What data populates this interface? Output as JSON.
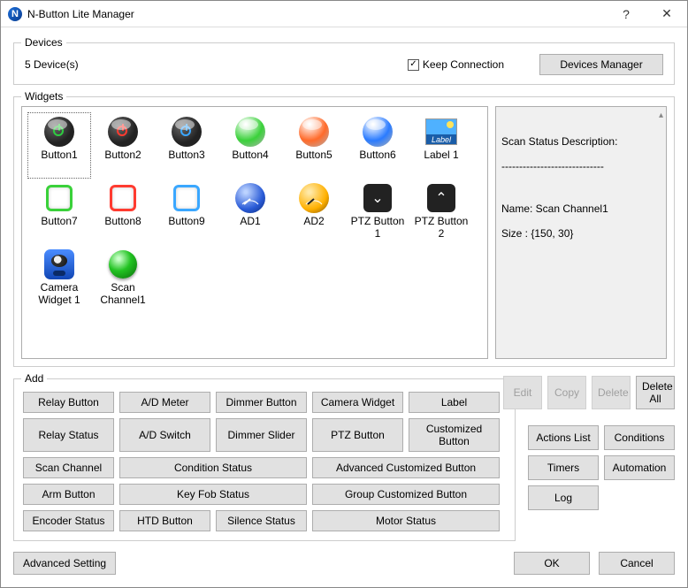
{
  "title": "N-Button Lite Manager",
  "titlebar": {
    "help": "?",
    "close": "✕"
  },
  "devices": {
    "legend": "Devices",
    "count_text": "5 Device(s)",
    "keep_label": "Keep Connection",
    "keep_checked": true,
    "manager_btn": "Devices Manager"
  },
  "widgets": {
    "legend": "Widgets",
    "items": [
      {
        "name": "Button1",
        "kind": "round",
        "bg": "#222",
        "fg": "#2ecc40",
        "selected": true
      },
      {
        "name": "Button2",
        "kind": "round",
        "bg": "#222",
        "fg": "#ff3b30"
      },
      {
        "name": "Button3",
        "kind": "round",
        "bg": "#222",
        "fg": "#3aa7ff"
      },
      {
        "name": "Button4",
        "kind": "dome",
        "bg": "#3ad13a"
      },
      {
        "name": "Button5",
        "kind": "dome",
        "bg": "#ff6a2a"
      },
      {
        "name": "Button6",
        "kind": "dome",
        "bg": "#2a7bff"
      },
      {
        "name": "Label 1",
        "kind": "label"
      },
      {
        "name": "Button7",
        "kind": "square",
        "border": "#3ad13a"
      },
      {
        "name": "Button8",
        "kind": "square",
        "border": "#ff3b30"
      },
      {
        "name": "Button9",
        "kind": "square",
        "border": "#3aa7ff"
      },
      {
        "name": "AD1",
        "kind": "gauge",
        "bg": "#2a5bd7"
      },
      {
        "name": "AD2",
        "kind": "gauge",
        "bg": "#ffb000"
      },
      {
        "name": "PTZ Button 1",
        "kind": "ptz",
        "arrow": "⌄"
      },
      {
        "name": "PTZ Button 2",
        "kind": "ptz",
        "arrow": "⌃"
      },
      {
        "name": "Camera Widget 1",
        "kind": "camera"
      },
      {
        "name": "Scan Channel1",
        "kind": "ball"
      }
    ],
    "desc_header": "Scan Status Description:",
    "desc_sep": "-----------------------------",
    "desc_name": "Name: Scan Channel1",
    "desc_size": "Size : {150, 30}"
  },
  "item_actions": {
    "edit": "Edit",
    "copy": "Copy",
    "delete": "Delete",
    "delete_all": "Delete All"
  },
  "add": {
    "legend": "Add",
    "rows": [
      [
        "Relay Button",
        "A/D Meter",
        "Dimmer Button",
        "Camera Widget",
        "Label"
      ],
      [
        "Relay Status",
        "A/D Switch",
        "Dimmer Slider",
        "PTZ Button",
        "Customized Button"
      ],
      [
        "Scan Channel",
        "Condition Status",
        "",
        "Advanced Customized Button",
        ""
      ],
      [
        "Arm Button",
        "Key Fob Status",
        "",
        "Group Customized Button",
        ""
      ],
      [
        "Encoder Status",
        "HTD Button",
        "Silence Status",
        "Motor Status",
        ""
      ]
    ]
  },
  "right_buttons": {
    "actions": "Actions List",
    "conditions": "Conditions",
    "timers": "Timers",
    "automation": "Automation",
    "log": "Log"
  },
  "bottom": {
    "advanced": "Advanced Setting",
    "ok": "OK",
    "cancel": "Cancel"
  }
}
